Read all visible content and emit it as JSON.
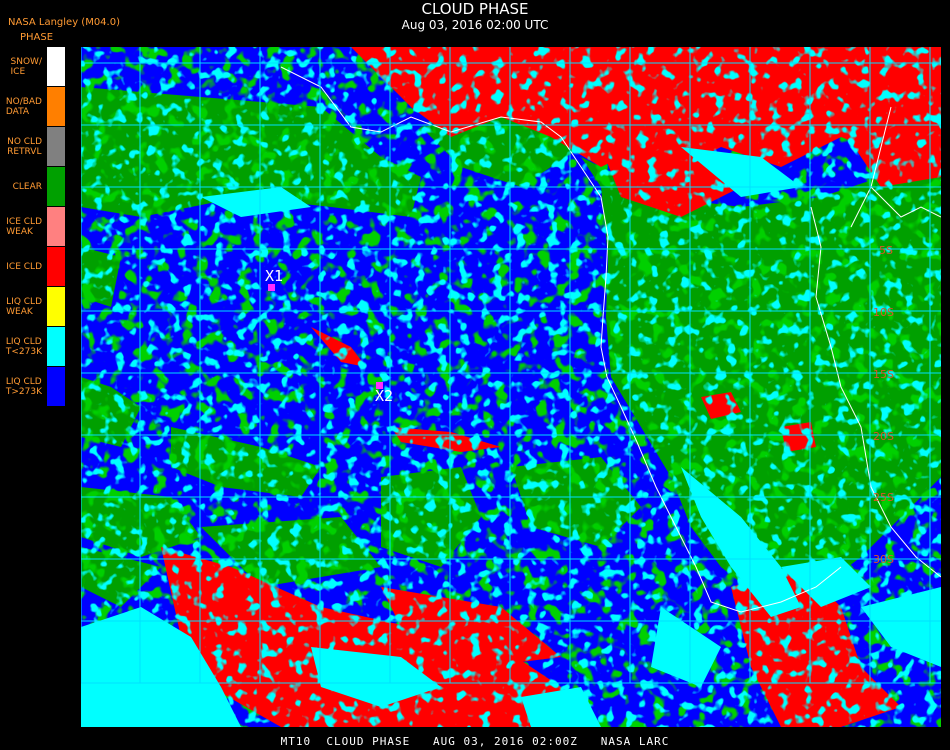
{
  "header": {
    "title": "CLOUD PHASE",
    "subtitle": "Aug 03, 2016 02:00 UTC",
    "producer": "NASA Langley (M04.0)"
  },
  "legend": {
    "title": "PHASE",
    "items": [
      {
        "label": "SNOW/\nICE",
        "color": "#ffffff"
      },
      {
        "label": "NO/BAD\nDATA",
        "color": "#ff7f00"
      },
      {
        "label": "NO CLD\nRETRVL",
        "color": "#808080"
      },
      {
        "label": "CLEAR",
        "color": "#00a000"
      },
      {
        "label": "ICE CLD\nWEAK",
        "color": "#ff8080"
      },
      {
        "label": "ICE CLD",
        "color": "#ff0000"
      },
      {
        "label": "LIQ CLD\nWEAK",
        "color": "#ffff00"
      },
      {
        "label": "LIQ CLD\nT<273K",
        "color": "#00ffff"
      },
      {
        "label": "LIQ CLD\nT>273K",
        "color": "#0000ff"
      }
    ]
  },
  "map": {
    "lat_labels": [
      "5S",
      "10S",
      "15S",
      "20S",
      "25S",
      "30S"
    ],
    "markers": [
      "X1",
      "X2"
    ],
    "colors": {
      "ocean_liquid": "#0000ff",
      "clear": "#00a000",
      "ice": "#ff0000",
      "liquid_cold": "#00ffff",
      "grid": "#00e0ff",
      "marker": "#ff2cff"
    }
  },
  "footer": {
    "text": "MT10  CLOUD PHASE   AUG 03, 2016 02:00Z   NASA LARC"
  }
}
